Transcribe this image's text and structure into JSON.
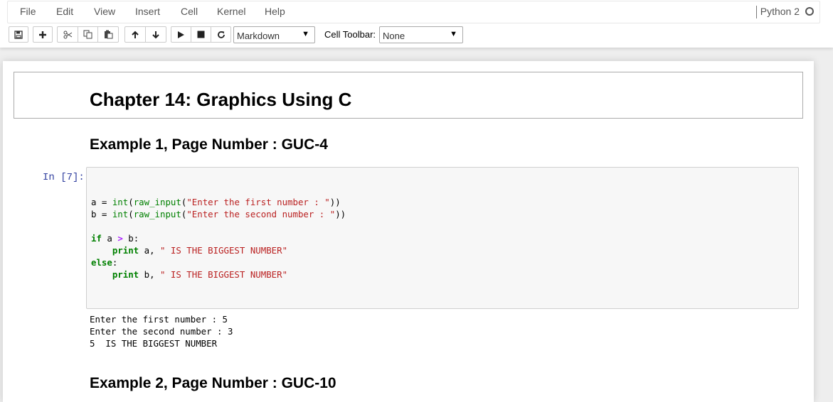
{
  "menu": [
    "File",
    "Edit",
    "View",
    "Insert",
    "Cell",
    "Kernel",
    "Help"
  ],
  "kernel": {
    "name": "Python 2"
  },
  "toolbar": {
    "buttons": [
      {
        "name": "save-button",
        "icon": "floppy-icon"
      },
      {
        "name": "insert-cell-button",
        "icon": "plus-icon"
      },
      {
        "name": "cut-button",
        "icon": "scissors-icon"
      },
      {
        "name": "copy-button",
        "icon": "copy-icon"
      },
      {
        "name": "paste-button",
        "icon": "paste-icon"
      },
      {
        "name": "move-up-button",
        "icon": "arrow-up-icon"
      },
      {
        "name": "move-down-button",
        "icon": "arrow-down-icon"
      },
      {
        "name": "run-button",
        "icon": "play-icon"
      },
      {
        "name": "interrupt-button",
        "icon": "stop-icon"
      },
      {
        "name": "restart-button",
        "icon": "restart-icon"
      }
    ],
    "cell_type": "Markdown",
    "cell_toolbar_label": "Cell Toolbar:",
    "cell_toolbar_value": "None"
  },
  "notebook": {
    "chapter_title": "Chapter 14: Graphics Using C",
    "example1_heading": "Example 1, Page Number : GUC-4",
    "prompt": "In [7]:",
    "code_lines": [
      "a = int(raw_input(\"Enter the first number : \"))",
      "b = int(raw_input(\"Enter the second number : \"))",
      "",
      "if a > b:",
      "    print a, \" IS THE BIGGEST NUMBER\"",
      "else:",
      "    print b, \" IS THE BIGGEST NUMBER\""
    ],
    "output_lines": [
      "Enter the first number : 5",
      "Enter the second number : 3",
      "5  IS THE BIGGEST NUMBER"
    ],
    "example2_heading": "Example 2, Page Number : GUC-10"
  },
  "colors": {
    "keyword": "#008000",
    "string": "#ba2121",
    "operator": "#aa22ff",
    "prompt": "#303f9f"
  }
}
